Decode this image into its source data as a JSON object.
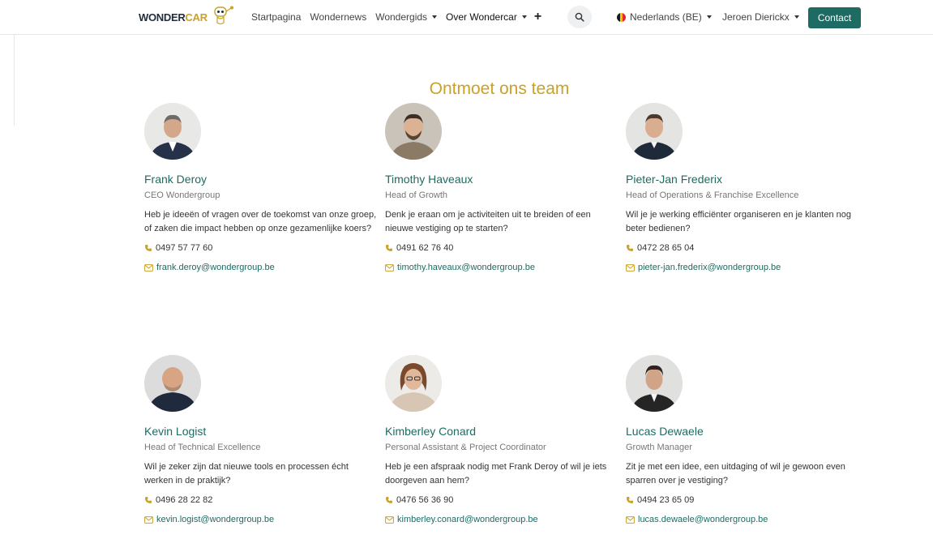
{
  "header": {
    "logo_text_a": "WONDER",
    "logo_text_b": "CAR",
    "nav": [
      {
        "label": "Startpagina"
      },
      {
        "label": "Wondernews"
      },
      {
        "label": "Wondergids"
      },
      {
        "label": "Over Wondercar"
      }
    ],
    "plus_label": "+",
    "language": "Nederlands (BE)",
    "user": "Jeroen Dierickx",
    "contact_label": "Contact"
  },
  "colors": {
    "accent": "#1d6b63",
    "gold": "#c9a227"
  },
  "section_title": "Ontmoet ons team",
  "team": [
    {
      "name": "Frank Deroy",
      "role": "CEO Wondergroup",
      "description": "Heb je ideeën of vragen over de toekomst van onze groep, of zaken die impact hebben op onze gezamenlijke koers?",
      "phone": "0497 57 77 60",
      "email": "frank.deroy@wondergroup.be"
    },
    {
      "name": "Timothy Haveaux",
      "role": "Head of Growth",
      "description": "Denk je eraan om je activiteiten uit te breiden of een nieuwe vestiging op te starten?",
      "phone": "0491 62 76 40",
      "email": "timothy.haveaux@wondergroup.be"
    },
    {
      "name": "Pieter-Jan Frederix",
      "role": "Head of Operations & Franchise Excellence",
      "description": "Wil je je werking efficiënter organiseren en je klanten nog beter bedienen?",
      "phone": "0472 28 65 04",
      "email": "pieter-jan.frederix@wondergroup.be"
    },
    {
      "name": "Kevin Logist",
      "role": "Head of Technical Excellence",
      "description": "Wil je zeker zijn dat nieuwe tools en processen écht werken in de praktijk?",
      "phone": "0496 28 22 82",
      "email": "kevin.logist@wondergroup.be"
    },
    {
      "name": "Kimberley Conard",
      "role": "Personal Assistant & Project Coordinator",
      "description": "Heb je een afspraak nodig met Frank Deroy of wil je iets doorgeven aan hem?",
      "phone": "0476 56 36 90",
      "email": "kimberley.conard@wondergroup.be"
    },
    {
      "name": "Lucas Dewaele",
      "role": "Growth Manager",
      "description": "Zit je met een idee, een uitdaging of wil je gewoon even sparren over je vestiging?",
      "phone": "0494 23 65 09",
      "email": "lucas.dewaele@wondergroup.be"
    }
  ]
}
